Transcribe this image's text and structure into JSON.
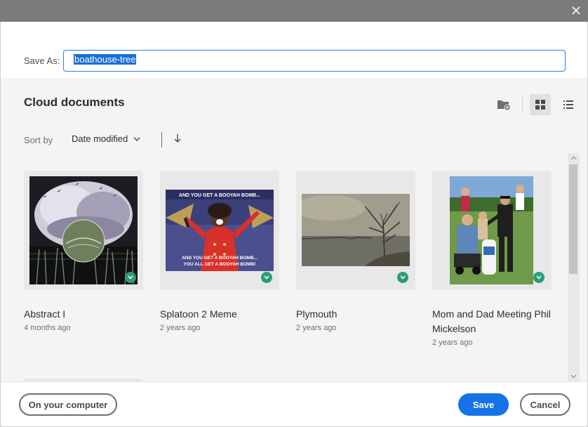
{
  "dialog": {
    "close_icon": "close-icon"
  },
  "save_as": {
    "label": "Save As:",
    "value": "boathouse-tree"
  },
  "section": {
    "title": "Cloud documents"
  },
  "toolbar": {
    "new_folder_icon": "new-folder-icon",
    "grid_view_icon": "grid-view-icon",
    "list_view_icon": "list-view-icon",
    "active_view": "grid"
  },
  "sort": {
    "label": "Sort by",
    "selected": "Date modified",
    "direction": "descending"
  },
  "documents": [
    {
      "name": "Abstract I",
      "date": "4 months ago",
      "synced": true
    },
    {
      "name": "Splatoon 2 Meme",
      "date": "2 years ago",
      "synced": true,
      "image_text_top": "AND YOU GET A BOOYAH BOMB...",
      "image_text_bottom_1": "AND YOU GET A BOOYAH BOMB...",
      "image_text_bottom_2": "YOU ALL GET A BOOYAH BOMB!"
    },
    {
      "name": "Plymouth",
      "date": "2 years ago",
      "synced": true
    },
    {
      "name": "Mom and Dad Meeting Phil Mickelson",
      "date": "2 years ago",
      "synced": true
    }
  ],
  "footer": {
    "on_computer_label": "On your computer",
    "save_label": "Save",
    "cancel_label": "Cancel"
  },
  "colors": {
    "accent": "#1473e6",
    "sync_badge": "#2d9d78",
    "titlebar": "#7b7b7b"
  }
}
